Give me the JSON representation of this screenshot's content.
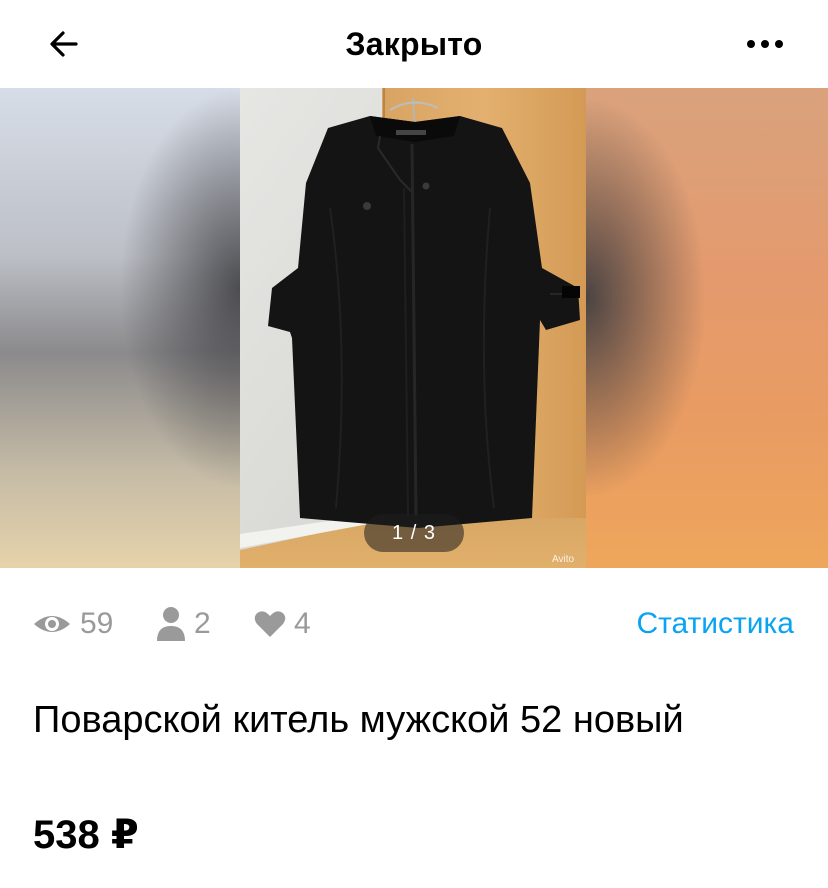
{
  "header": {
    "title": "Закрыто",
    "back_icon": "arrow-left-icon",
    "more_icon": "more-horizontal-icon"
  },
  "gallery": {
    "counter": "1 / 3",
    "watermark": "Avito"
  },
  "stats": {
    "views": "59",
    "contacts": "2",
    "favorites": "4",
    "link_label": "Статистика",
    "link_color": "#0aa3f2",
    "icon_color": "#9a9a9a"
  },
  "listing": {
    "title": "Поварской китель мужской 52 новый",
    "price": "538 ₽"
  }
}
